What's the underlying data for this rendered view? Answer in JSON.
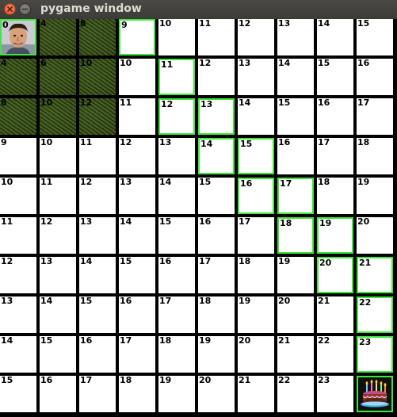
{
  "window": {
    "title": "pygame window"
  },
  "board": {
    "rows": 10,
    "cols": 10,
    "values": [
      [
        0,
        4,
        8,
        9,
        10,
        11,
        12,
        13,
        14,
        15
      ],
      [
        4,
        6,
        10,
        10,
        11,
        12,
        13,
        14,
        15,
        16
      ],
      [
        8,
        10,
        12,
        11,
        12,
        13,
        14,
        15,
        16,
        17
      ],
      [
        9,
        10,
        11,
        12,
        13,
        14,
        15,
        16,
        17,
        18
      ],
      [
        10,
        11,
        12,
        13,
        14,
        15,
        16,
        17,
        18,
        19
      ],
      [
        11,
        12,
        13,
        14,
        15,
        16,
        17,
        18,
        19,
        20
      ],
      [
        12,
        13,
        14,
        15,
        16,
        17,
        18,
        19,
        20,
        21
      ],
      [
        13,
        14,
        15,
        16,
        17,
        18,
        19,
        20,
        21,
        22
      ],
      [
        14,
        15,
        16,
        17,
        18,
        19,
        20,
        21,
        22,
        23
      ],
      [
        15,
        16,
        17,
        18,
        19,
        20,
        21,
        22,
        23,
        ""
      ]
    ],
    "grass_cells": [
      [
        0,
        1
      ],
      [
        0,
        2
      ],
      [
        1,
        0
      ],
      [
        1,
        1
      ],
      [
        1,
        2
      ],
      [
        2,
        0
      ],
      [
        2,
        1
      ],
      [
        2,
        2
      ]
    ],
    "path_cells": [
      [
        0,
        3
      ],
      [
        1,
        4
      ],
      [
        2,
        4
      ],
      [
        2,
        5
      ],
      [
        3,
        5
      ],
      [
        3,
        6
      ],
      [
        4,
        6
      ],
      [
        4,
        7
      ],
      [
        5,
        7
      ],
      [
        5,
        8
      ],
      [
        6,
        8
      ],
      [
        6,
        9
      ],
      [
        7,
        9
      ],
      [
        8,
        9
      ],
      [
        9,
        9
      ]
    ],
    "start_cell": [
      0,
      0
    ],
    "goal_cell": [
      9,
      9
    ],
    "start_icon": "player-face-icon",
    "goal_icon": "birthday-cake-icon"
  },
  "colors": {
    "path_border": "#3ee83a",
    "cell_bg": "#ffffff",
    "grid_line": "#000000",
    "titlebar": "#3c3b37",
    "close_button": "#e0532a"
  }
}
